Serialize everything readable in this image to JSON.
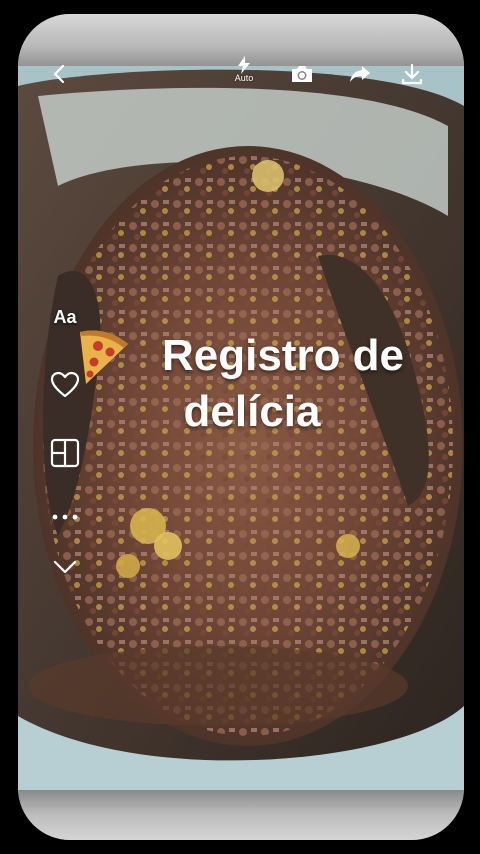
{
  "toolbar": {
    "back_icon": "back-arrow-icon",
    "flash_icon": "flash-icon",
    "flash_label": "Auto",
    "camera_icon": "camera-icon",
    "share_icon": "share-arrow-icon",
    "download_icon": "download-icon"
  },
  "side_tools": {
    "text_label": "Aa",
    "favorite_icon": "heart-icon",
    "layout_icon": "layout-grid-icon",
    "more_icon": "more-dots-icon",
    "collapse_icon": "chevron-down-icon"
  },
  "caption": {
    "emoji_icon": "pizza-icon",
    "line1": "Registro de",
    "line2": "delícia"
  },
  "colors": {
    "background": "#000000",
    "caption_text": "#ffffff",
    "icon": "#ffffff"
  }
}
